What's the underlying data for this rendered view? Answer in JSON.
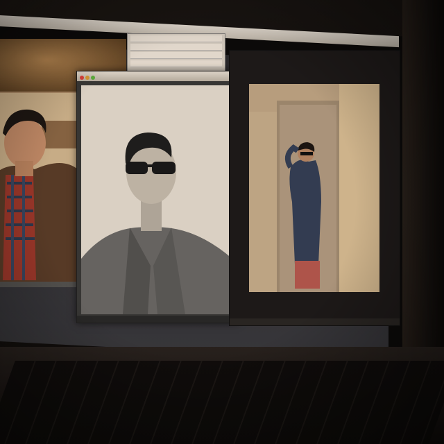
{
  "scene": {
    "description_tag": "photo-editing-on-laptop",
    "accent_colors": {
      "wall": "#5a4a3a",
      "bezel": "#0f0c0a",
      "left_photo_top": "#b88b55",
      "center_photo_bg": "#e9e5dd",
      "right_photo_bg": "#c9b79b"
    },
    "icons": [
      "traffic-light-close",
      "traffic-light-minimize",
      "traffic-light-zoom"
    ]
  }
}
